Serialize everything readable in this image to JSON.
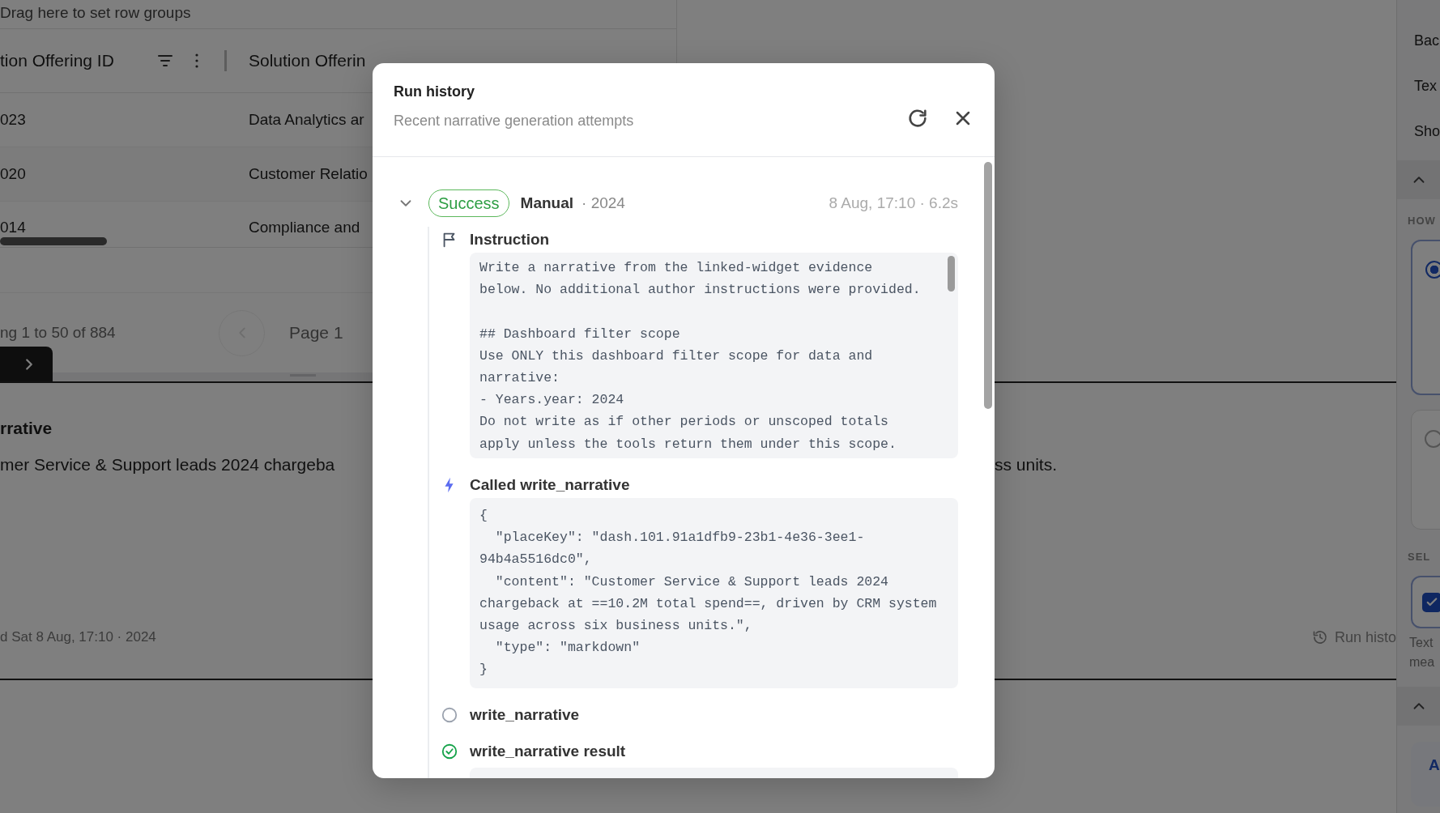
{
  "grid": {
    "group_hint": "Drag here to set row groups",
    "columns": [
      "tion Offering ID",
      "Solution Offerin"
    ],
    "rows": [
      [
        "023",
        "Data Analytics ar"
      ],
      [
        "020",
        "Customer Relatio"
      ],
      [
        "014",
        "Compliance and"
      ]
    ],
    "row_count": "ng 1 to 50 of 884",
    "page": "Page 1"
  },
  "narrative": {
    "title": "rrative",
    "text_left": "mer Service & Support leads 2024 chargeba",
    "text_right": "ss units.",
    "updated": "d Sat 8 Aug, 17:10 · 2024",
    "run_history_link": "Run histo"
  },
  "side_panel": {
    "labels": [
      "Bac",
      "Tex",
      "Sho"
    ],
    "section_label": "HOW",
    "options": [
      {
        "selected": true
      },
      {
        "selected": false
      }
    ],
    "select_label": "SEL",
    "checkbox": {
      "checked": true
    },
    "help_lines": [
      "Text",
      "mea"
    ],
    "card_text": "A"
  },
  "dialog": {
    "title": "Run history",
    "subtitle": "Recent narrative generation attempts",
    "runs": [
      {
        "expanded": true,
        "status": "Success",
        "trigger": "Manual",
        "scope": "· 2024",
        "time": "8 Aug, 17:10 · 6.2s",
        "steps": [
          {
            "kind": "instruction",
            "label": "Instruction",
            "code": "Write a narrative from the linked-widget evidence\nbelow. No additional author instructions were provided.\n\n## Dashboard filter scope\nUse ONLY this dashboard filter scope for data and\nnarrative:\n- Years.year: 2024\nDo not write as if other periods or unscoped totals\napply unless the tools return them under this scope."
          },
          {
            "kind": "call",
            "label": "Called write_narrative",
            "code": "{\n  \"placeKey\": \"dash.101.91a1dfb9-23b1-4e36-3ee1-\n94b4a5516dc0\",\n  \"content\": \"Customer Service & Support leads 2024\nchargeback at ==10.2M total spend==, driven by CRM system\nusage across six business units.\",\n  \"type\": \"markdown\"\n}"
          },
          {
            "kind": "pending",
            "label": "write_narrative"
          },
          {
            "kind": "result",
            "label": "write_narrative result"
          }
        ]
      }
    ]
  }
}
